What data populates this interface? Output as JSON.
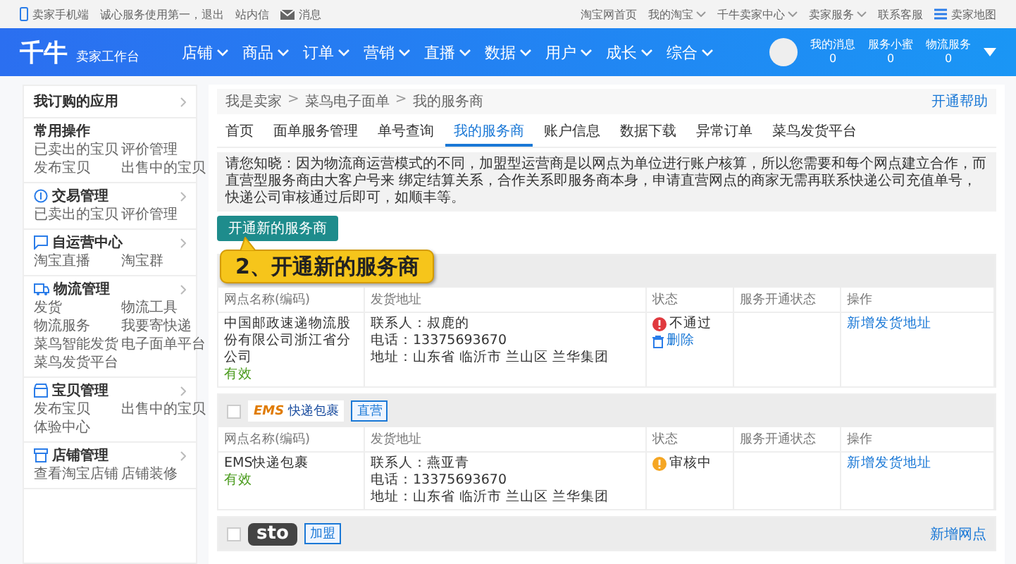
{
  "top_bar": {
    "left": [
      "卖家手机端",
      "诚心服务使用第一，退出",
      "站内信",
      "消息"
    ],
    "right": [
      {
        "text": "淘宝网首页",
        "caret": false
      },
      {
        "text": "我的淘宝",
        "caret": true
      },
      {
        "text": "千牛卖家中心",
        "caret": true
      },
      {
        "text": "卖家服务",
        "caret": true
      },
      {
        "text": "联系客服",
        "caret": false
      },
      {
        "text": "卖家地图",
        "caret": false
      }
    ]
  },
  "header": {
    "logo": "千牛",
    "subtitle": "卖家工作台",
    "nav": [
      "店铺",
      "商品",
      "订单",
      "营销",
      "直播",
      "数据",
      "用户",
      "成长",
      "综合"
    ],
    "stats": [
      {
        "label": "我的消息",
        "value": "0"
      },
      {
        "label": "服务小蜜",
        "value": "0"
      },
      {
        "label": "物流服务",
        "value": "0"
      }
    ]
  },
  "sidebar": {
    "title": "我订购的应用",
    "sections": [
      {
        "title": "常用操作",
        "arrow": false,
        "links": [
          "已卖出的宝贝",
          "评价管理",
          "发布宝贝",
          "出售中的宝贝"
        ]
      },
      {
        "title": "交易管理",
        "arrow": true,
        "links": [
          "已卖出的宝贝",
          "评价管理"
        ]
      },
      {
        "title": "自运营中心",
        "arrow": true,
        "links": [
          "淘宝直播",
          "淘宝群"
        ]
      },
      {
        "title": "物流管理",
        "arrow": true,
        "links": [
          "发货",
          "物流工具",
          "物流服务",
          "我要寄快递",
          "菜鸟智能发货",
          "电子面单平台",
          "菜鸟发货平台"
        ]
      },
      {
        "title": "宝贝管理",
        "arrow": true,
        "links": [
          "发布宝贝",
          "出售中的宝贝",
          "体验中心"
        ]
      },
      {
        "title": "店铺管理",
        "arrow": true,
        "links": [
          "查看淘宝店铺",
          "店铺装修"
        ]
      }
    ]
  },
  "breadcrumb": [
    {
      "text": "我是卖家"
    },
    {
      "separator": ">",
      "text": "菜鸟电子面单"
    },
    {
      "separator": ">",
      "text": "我的服务商"
    }
  ],
  "help_link": "开通帮助",
  "tabs": [
    {
      "label": "首页",
      "selected": false
    },
    {
      "label": "面单服务管理",
      "selected": false
    },
    {
      "label": "单号查询",
      "selected": false
    },
    {
      "label": "我的服务商",
      "selected": true
    },
    {
      "label": "账户信息",
      "selected": false
    },
    {
      "label": "数据下载",
      "selected": false
    },
    {
      "label": "异常订单",
      "selected": false
    },
    {
      "label": "菜鸟发货平台",
      "selected": false
    }
  ],
  "notice": "请您知晓：因为物流商运营模式的不同，加盟型运营商是以网点为单位进行账户核算，所以您需要和每个网点建立合作，而直营型服务商由大客户号来 绑定结算关系，合作关系即服务商本身，申请直营网点的商家无需再联系快递公司充值单号，快递公司审核通过后即可，如顺丰等。",
  "open_button": "开通新的服务商",
  "callout": "2、开通新的服务商",
  "providers": [
    {
      "columns": [
        "网点名称(编码)",
        "发货地址",
        "状态",
        "服务开通状态",
        "操作"
      ],
      "rows": [
        {
          "name": "中国邮政速递物流股份有限公司浙江省分公司",
          "validity": "有效",
          "contact": "联系人：叔鹿的",
          "phone": "电话：13375693670",
          "address": "地址：山东省 临沂市 兰山区 兰华集团",
          "status": {
            "kind": "rejected",
            "text": "不通过"
          },
          "delete": "删除",
          "action": "新增发货地址"
        }
      ]
    },
    {
      "logo": "EMS",
      "logo_sub": "快递包裹",
      "tag": "直营",
      "columns": [
        "网点名称(编码)",
        "发货地址",
        "状态",
        "服务开通状态",
        "操作"
      ],
      "rows": [
        {
          "name": "EMS快递包裹",
          "validity": "有效",
          "contact": "联系人：燕亚青",
          "phone": "电话：13375693670",
          "address": "地址：山东省 临沂市 兰山区 兰华集团",
          "status": {
            "kind": "pending",
            "text": "审核中"
          },
          "action": "新增发货地址"
        }
      ]
    },
    {
      "logo": "sto",
      "tag": "加盟",
      "header_action": "新增网点"
    }
  ]
}
